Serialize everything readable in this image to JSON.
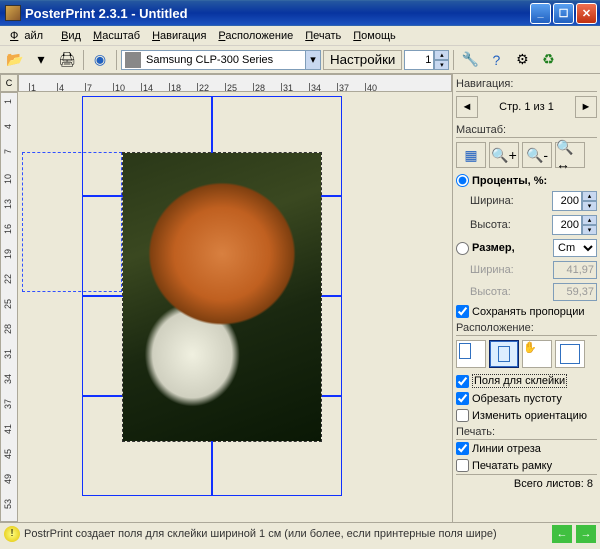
{
  "window": {
    "title": "PosterPrint 2.3.1 - Untitled"
  },
  "menu": {
    "file": "Файл",
    "view": "Вид",
    "zoom": "Масштаб",
    "nav": "Навигация",
    "layout": "Расположение",
    "print": "Печать",
    "help": "Помощь"
  },
  "toolbar": {
    "printer": "Samsung CLP-300 Series",
    "settings_btn": "Настройки",
    "copies": "1"
  },
  "rulers": {
    "corner": "C",
    "h_ticks": [
      "1",
      "4",
      "7",
      "10",
      "14",
      "18",
      "22",
      "25",
      "28",
      "31",
      "34",
      "37",
      "40"
    ],
    "v_ticks": [
      "1",
      "4",
      "7",
      "10",
      "13",
      "16",
      "19",
      "22",
      "25",
      "28",
      "31",
      "34",
      "37",
      "41",
      "45",
      "49",
      "53"
    ]
  },
  "nav": {
    "title": "Навигация:",
    "page_label": "Стр. 1 из 1"
  },
  "zoom": {
    "title": "Масштаб:",
    "percent_label": "Проценты, %:",
    "width_label": "Ширина:",
    "width_val": "200",
    "height_label": "Высота:",
    "height_val": "200",
    "size_label": "Размер,",
    "size_unit": "Cm",
    "size_width_label": "Ширина:",
    "size_width_val": "41,97",
    "size_height_label": "Высота:",
    "size_height_val": "59,37",
    "keep_label": "Сохранять пропорции"
  },
  "layout": {
    "title": "Расположение:",
    "glue_label": "Поля для склейки",
    "trim_label": "Обрезать пустоту",
    "orient_label": "Изменить ориентацию"
  },
  "print": {
    "title": "Печать:",
    "cut_label": "Линии отреза",
    "frame_label": "Печатать рамку"
  },
  "footer": {
    "total": "Всего листов: 8",
    "tip": "PostrPrint создает поля для склейки шириной 1 см (или более, если принтерные поля шире)"
  }
}
